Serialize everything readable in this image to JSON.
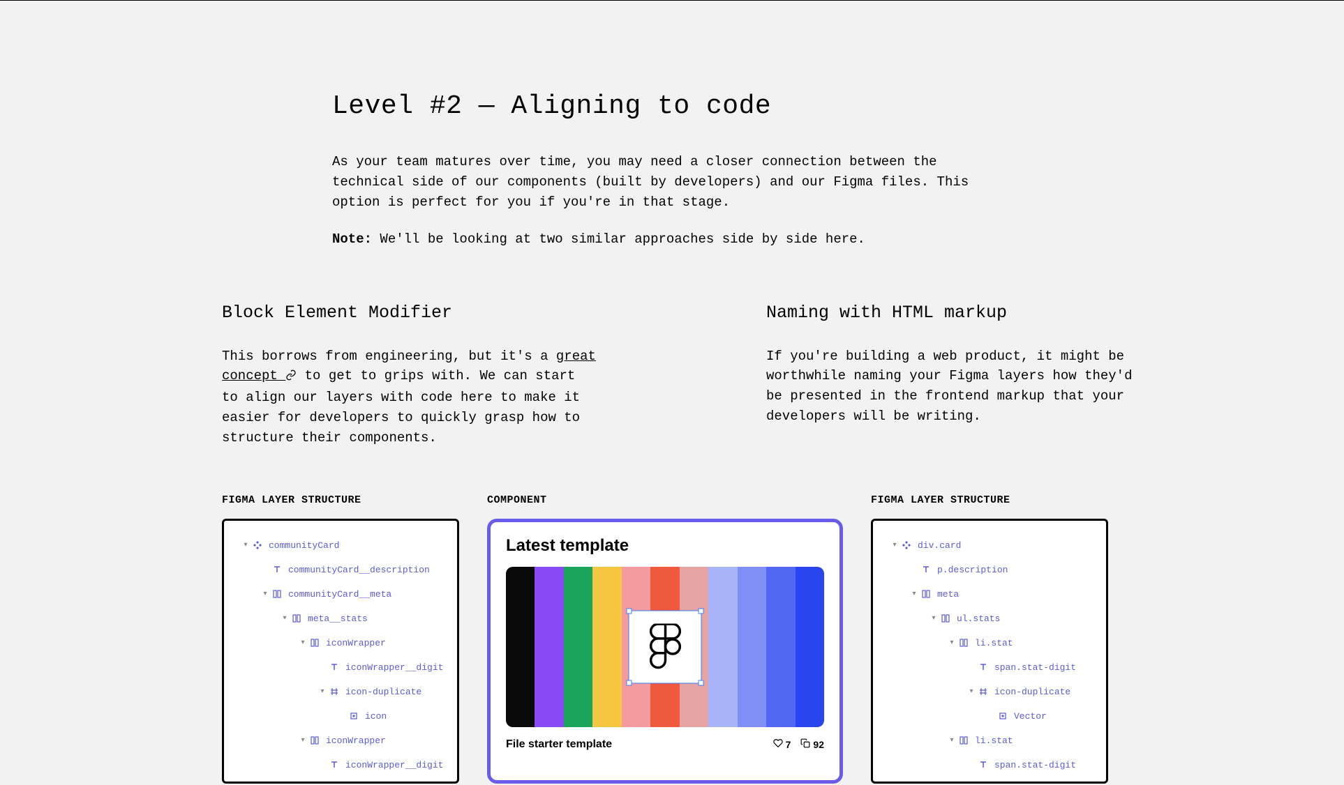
{
  "intro": {
    "title": "Level #2 — Aligning to code",
    "p1": "As your team matures over time, you may need a closer connection between the technical side of our components (built by developers) and our Figma files. This option is perfect for you if you're in that stage.",
    "note_label": "Note:",
    "note_text": " We'll be looking at two similar approaches side by side here."
  },
  "left": {
    "h": "Block Element Modifier",
    "p_a": "This borrows from engineering, but it's a ",
    "link": "great concept",
    "p_b": " to get to grips with. We can start to align our layers with code here to make it easier for developers to quickly grasp how to structure their components."
  },
  "right": {
    "h": "Naming with HTML markup",
    "p": "If you're building a web product, it might be worthwhile naming your Figma layers how they'd be presented in the frontend markup that your developers will be writing."
  },
  "labels": {
    "layer": "FIGMA LAYER STRUCTURE",
    "component": "COMPONENT"
  },
  "tree_left": [
    {
      "indent": 0,
      "chev": "▾",
      "icon": "component",
      "label": "communityCard"
    },
    {
      "indent": 1,
      "chev": "",
      "icon": "text",
      "label": "communityCard__description"
    },
    {
      "indent": 1,
      "chev": "▾",
      "icon": "frame",
      "label": "communityCard__meta"
    },
    {
      "indent": 2,
      "chev": "▾",
      "icon": "frame",
      "label": "meta__stats"
    },
    {
      "indent": 3,
      "chev": "▾",
      "icon": "frame",
      "label": "iconWrapper"
    },
    {
      "indent": 4,
      "chev": "",
      "icon": "text",
      "label": "iconWrapper__digit"
    },
    {
      "indent": 4,
      "chev": "▾",
      "icon": "hash",
      "label": "icon-duplicate"
    },
    {
      "indent": 5,
      "chev": "",
      "icon": "vector",
      "label": "icon"
    },
    {
      "indent": 3,
      "chev": "▾",
      "icon": "frame",
      "label": "iconWrapper"
    },
    {
      "indent": 4,
      "chev": "",
      "icon": "text",
      "label": "iconWrapper__digit"
    }
  ],
  "tree_right": [
    {
      "indent": 0,
      "chev": "▾",
      "icon": "component",
      "label": "div.card"
    },
    {
      "indent": 1,
      "chev": "",
      "icon": "text",
      "label": "p.description"
    },
    {
      "indent": 1,
      "chev": "▾",
      "icon": "frame",
      "label": "meta"
    },
    {
      "indent": 2,
      "chev": "▾",
      "icon": "frame",
      "label": "ul.stats"
    },
    {
      "indent": 3,
      "chev": "▾",
      "icon": "frame",
      "label": "li.stat"
    },
    {
      "indent": 4,
      "chev": "",
      "icon": "text",
      "label": "span.stat-digit"
    },
    {
      "indent": 4,
      "chev": "▾",
      "icon": "hash",
      "label": "icon-duplicate"
    },
    {
      "indent": 5,
      "chev": "",
      "icon": "vector",
      "label": "Vector"
    },
    {
      "indent": 3,
      "chev": "▾",
      "icon": "frame",
      "label": "li.stat"
    },
    {
      "indent": 4,
      "chev": "",
      "icon": "text",
      "label": "span.stat-digit"
    }
  ],
  "component": {
    "title": "Latest template",
    "name": "File starter template",
    "likes": "7",
    "copies": "92",
    "stripes": [
      "#2845f0",
      "#5268f2",
      "#7f8ff5",
      "#a9b4f8",
      "#e6a3a4",
      "#ef5a3e",
      "#f49ba0",
      "#f5c642",
      "#18a45b",
      "#8a4af3",
      "#0a0a0a"
    ]
  }
}
